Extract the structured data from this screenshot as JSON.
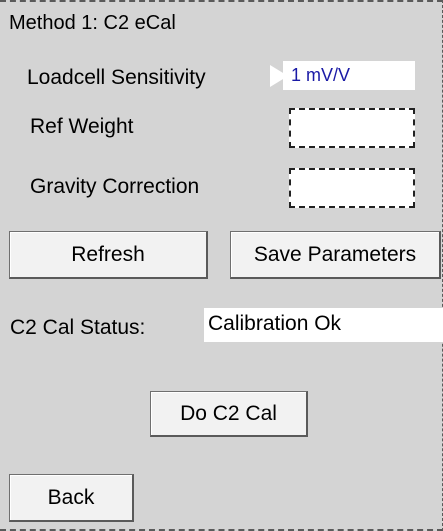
{
  "method_title": "Method 1: C2 eCal",
  "fields": {
    "loadcell_sensitivity": {
      "label": "Loadcell Sensitivity",
      "value": "1 mV/V"
    },
    "ref_weight": {
      "label": "Ref Weight",
      "value": ""
    },
    "gravity_correction": {
      "label": "Gravity Correction",
      "value": ""
    }
  },
  "buttons": {
    "refresh": "Refresh",
    "save_parameters": "Save Parameters",
    "do_c2_cal": "Do C2 Cal",
    "back": "Back"
  },
  "status": {
    "label": "C2 Cal Status:",
    "value": "Calibration Ok"
  }
}
